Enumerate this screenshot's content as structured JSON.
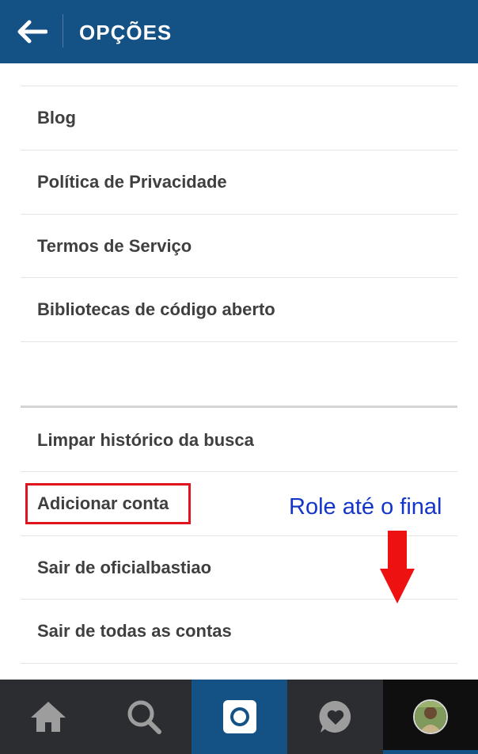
{
  "header": {
    "title": "OPÇÕES",
    "back_icon": "arrow-left-icon"
  },
  "menu": {
    "group1": [
      {
        "label": "Blog"
      },
      {
        "label": "Política de Privacidade"
      },
      {
        "label": "Termos de Serviço"
      },
      {
        "label": "Bibliotecas de código aberto"
      }
    ],
    "group2": [
      {
        "label": "Limpar histórico da busca"
      },
      {
        "label": "Adicionar conta"
      },
      {
        "label": "Sair de oficialbastiao"
      },
      {
        "label": "Sair de todas as contas"
      }
    ]
  },
  "annotation": {
    "text": "Role até o final",
    "text_color": "#1336c9",
    "highlight_color": "#e0141e",
    "arrow_color": "#ee1111"
  },
  "bottom_nav": {
    "tabs": [
      {
        "icon": "home-icon"
      },
      {
        "icon": "search-icon"
      },
      {
        "icon": "camera-icon"
      },
      {
        "icon": "activity-heart-icon"
      },
      {
        "icon": "profile-avatar"
      }
    ]
  },
  "colors": {
    "brand_blue": "#145185",
    "nav_background": "#2b2d30"
  }
}
